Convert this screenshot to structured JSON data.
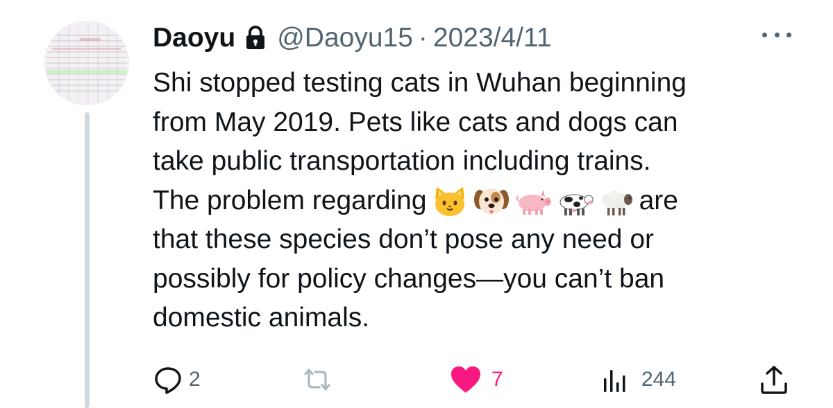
{
  "tweet": {
    "author_name": "Daoyu",
    "handle": "@Daoyu15",
    "separator": "·",
    "date": "2023/4/11",
    "protected": true,
    "text_lines": [
      "Shi stopped testing cats in Wuhan beginning",
      "from May 2019. Pets like cats and dogs can",
      "take public transportation including trains.",
      "The problem regarding",
      "are",
      "that these species don’t pose any need or",
      "possibly for policy changes—you can’t ban",
      "domestic animals."
    ],
    "inline_emojis": [
      "cat-face-icon",
      "dog-face-icon",
      "pig-icon",
      "cow-icon",
      "sheep-icon"
    ]
  },
  "actions": {
    "replies": "2",
    "reposts": "",
    "likes": "7",
    "views": "244",
    "liked": true
  },
  "colors": {
    "text": "#0f1419",
    "secondary": "#536471",
    "like": "#f91880",
    "thread_line": "#cfd9de"
  }
}
